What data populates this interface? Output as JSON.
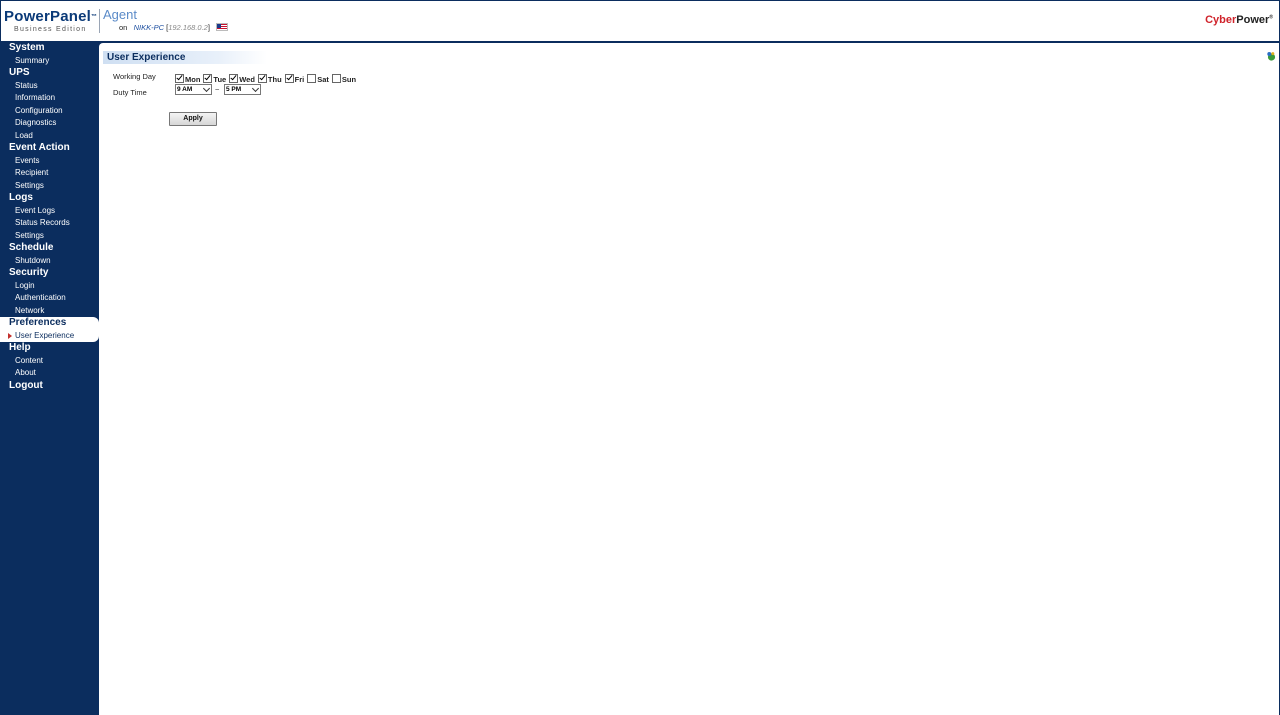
{
  "header": {
    "brand_name": "PowerPanel",
    "brand_tm": "™",
    "brand_edition": "Business Edition",
    "agent_title": "Agent",
    "agent_on": "on",
    "host_name": "NIKK-PC",
    "host_ip_open": "[",
    "host_ip": "192.168.0.2",
    "host_ip_close": "]",
    "flag_icon": "us-flag-icon",
    "vendor_cyber": "Cyber",
    "vendor_power": "Power",
    "vendor_mark": "®"
  },
  "sidebar": {
    "groups": [
      {
        "title": "System",
        "items": [
          "Summary"
        ]
      },
      {
        "title": "UPS",
        "items": [
          "Status",
          "Information",
          "Configuration",
          "Diagnostics",
          "Load"
        ]
      },
      {
        "title": "Event Action",
        "items": [
          "Events",
          "Recipient",
          "Settings"
        ]
      },
      {
        "title": "Logs",
        "items": [
          "Event Logs",
          "Status Records",
          "Settings"
        ]
      },
      {
        "title": "Schedule",
        "items": [
          "Shutdown"
        ]
      },
      {
        "title": "Security",
        "items": [
          "Login",
          "Authentication",
          "Network"
        ]
      },
      {
        "title": "Preferences",
        "items": [
          "User Experience"
        ]
      },
      {
        "title": "Help",
        "items": [
          "Content",
          "About"
        ]
      }
    ],
    "logout": "Logout",
    "active_group": "Preferences",
    "active_item": "User Experience"
  },
  "main": {
    "page_title": "User Experience",
    "help_icon": "help-icon",
    "working_day_label": "Working Day",
    "days": [
      {
        "label": "Mon",
        "checked": true
      },
      {
        "label": "Tue",
        "checked": true
      },
      {
        "label": "Wed",
        "checked": true
      },
      {
        "label": "Thu",
        "checked": true
      },
      {
        "label": "Fri",
        "checked": true
      },
      {
        "label": "Sat",
        "checked": false
      },
      {
        "label": "Sun",
        "checked": false
      }
    ],
    "duty_time_label": "Duty Time",
    "duty_start": "9 AM",
    "duty_separator": "~",
    "duty_end": "5 PM",
    "apply_label": "Apply"
  }
}
